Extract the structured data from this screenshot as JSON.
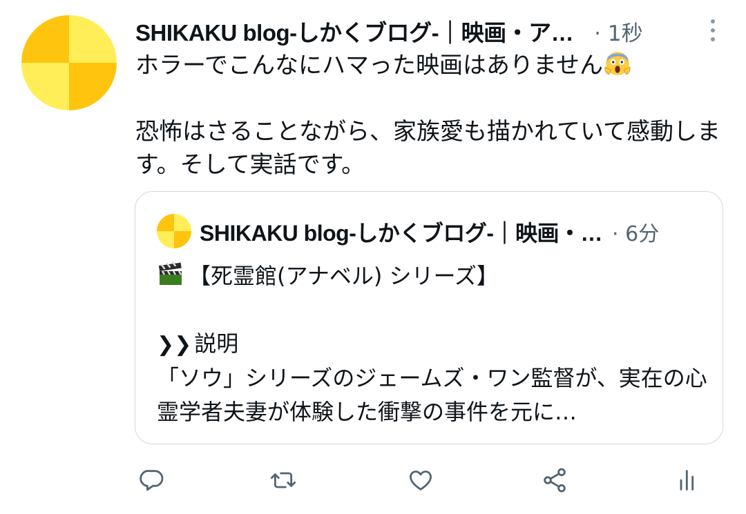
{
  "tweet": {
    "author_name": "SHIKAKU blog-しかくブログ-｜映画・ア…",
    "time": "· 1秒",
    "text_line1": "ホラーでこんなにハマった映画はありません",
    "text_rest": "\n\n恐怖はさることながら、家族愛も描かれていて感動します。そして実話です。",
    "emoji_icon": "face-screaming-in-fear-icon"
  },
  "quoted_tweet": {
    "author_name": "SHIKAKU blog-しかくブログ-｜映画・…",
    "time": "· 6分",
    "title": "【死霊館(アナベル) シリーズ】",
    "section_label": "説明",
    "description": "「ソウ」シリーズのジェームズ・ワン監督が、実在の心霊学者夫妻が体験した衝撃の事件を元に…",
    "clapper_icon": "clapper-board-icon",
    "chevron_glyph": "❯❯"
  },
  "actions": [
    "reply-icon",
    "retweet-icon",
    "like-icon",
    "share-icon",
    "views-icon"
  ],
  "colors": {
    "avatar_yellow": "#ffee58",
    "avatar_orange": "#ffc40d",
    "icon_gray": "#536471"
  }
}
